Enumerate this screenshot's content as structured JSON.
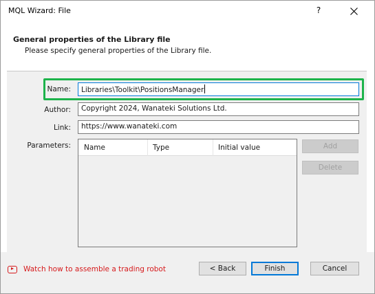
{
  "window": {
    "title": "MQL Wizard: File",
    "help_glyph": "?"
  },
  "header": {
    "title": "General properties of the Library file",
    "subtitle": "Please specify general properties of the Library file."
  },
  "form": {
    "name_label": "Name:",
    "name_value": "Libraries\\Toolkit\\PositionsManager",
    "author_label": "Author:",
    "author_value": "Copyright 2024, Wanateki Solutions Ltd.",
    "link_label": "Link:",
    "link_value": "https://www.wanateki.com",
    "parameters_label": "Parameters:"
  },
  "parameters_table": {
    "columns": [
      "Name",
      "Type",
      "Initial value"
    ],
    "rows": []
  },
  "side_buttons": {
    "add": "Add",
    "delete": "Delete"
  },
  "footer": {
    "link_text": "Watch how to assemble a trading robot",
    "link_icon": "video-play-icon",
    "back": "< Back",
    "finish": "Finish",
    "cancel": "Cancel"
  },
  "colors": {
    "highlight": "#1db34b",
    "link": "#d6191b",
    "focus": "#0078d7"
  }
}
